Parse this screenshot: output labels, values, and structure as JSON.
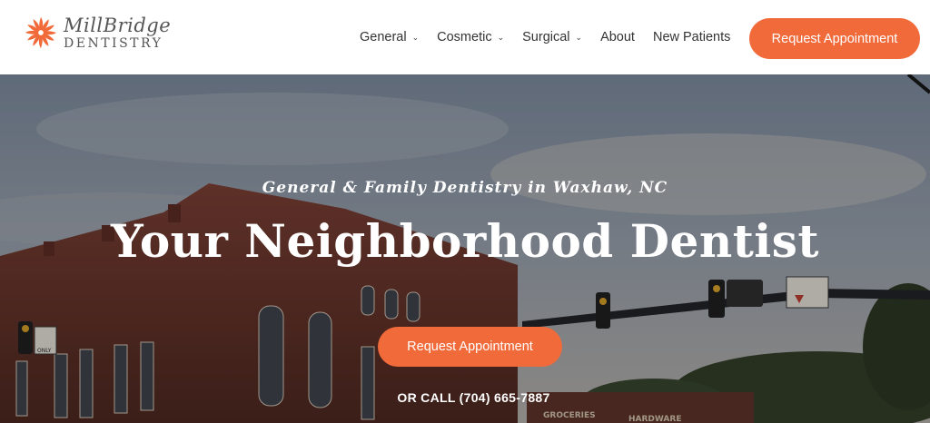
{
  "brand": {
    "line1": "MillBridge",
    "line2": "DENTISTRY",
    "logo_icon": "pinwheel-icon",
    "accent_color": "#f16a3a"
  },
  "nav": {
    "items": [
      {
        "label": "General",
        "has_dropdown": true
      },
      {
        "label": "Cosmetic",
        "has_dropdown": true
      },
      {
        "label": "Surgical",
        "has_dropdown": true
      },
      {
        "label": "About",
        "has_dropdown": false
      },
      {
        "label": "New Patients",
        "has_dropdown": false
      }
    ],
    "dropdown_icon": "chevron-down-icon",
    "cta_label": "Request Appointment"
  },
  "hero": {
    "tagline": "General & Family Dentistry in Waxhaw, NC",
    "headline": "Your Neighborhood Dentist",
    "cta_label": "Request Appointment",
    "call_text": "OR CALL (704) 665-7887",
    "signs": {
      "only": "ONLY",
      "groceries": "GROCERIES",
      "hardware": "HARDWARE"
    }
  }
}
